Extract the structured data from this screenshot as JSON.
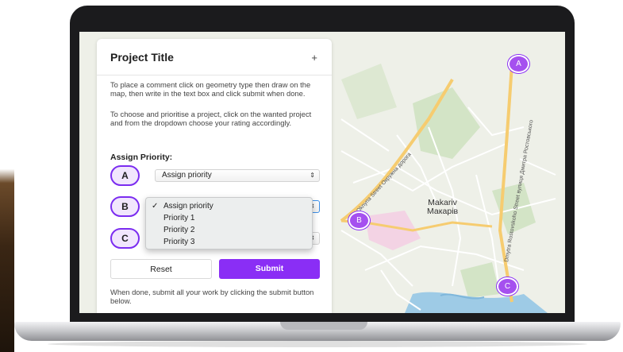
{
  "panel": {
    "title": "Project Title",
    "add_symbol": "+",
    "instructions_1": "To place a comment click on geometry type then draw on the map, then write in the text box and click submit when done.",
    "instructions_2": "To choose and prioritise a project, click on the wanted project and from the dropdown choose your rating accordingly.",
    "assign_label": "Assign Priority:",
    "rows": [
      {
        "badge": "A",
        "select_value": "Assign priority"
      },
      {
        "badge": "B",
        "select_value": ""
      },
      {
        "badge": "C",
        "select_value": ""
      }
    ],
    "dropdown": {
      "checkmark": "✓",
      "options": [
        "Assign priority",
        "Priority 1",
        "Priority 2",
        "Priority 3"
      ],
      "selected": "Assign priority"
    },
    "reset_label": "Reset",
    "submit_label": "Submit",
    "footer_text": "When done, submit all your work by clicking the submit button below."
  },
  "map": {
    "town_name_en": "Makariv",
    "town_name_uk": "Макарів",
    "markers": [
      "A",
      "B",
      "C"
    ],
    "street_1": "Oknyna Street Окружна дорога",
    "street_2": "Dmytra Rostovskoho Street вулиця Дмитра Ростовського"
  },
  "colors": {
    "accent": "#8a2ef5",
    "marker": "#a550ef",
    "badge_bg": "#f1e6fd"
  }
}
